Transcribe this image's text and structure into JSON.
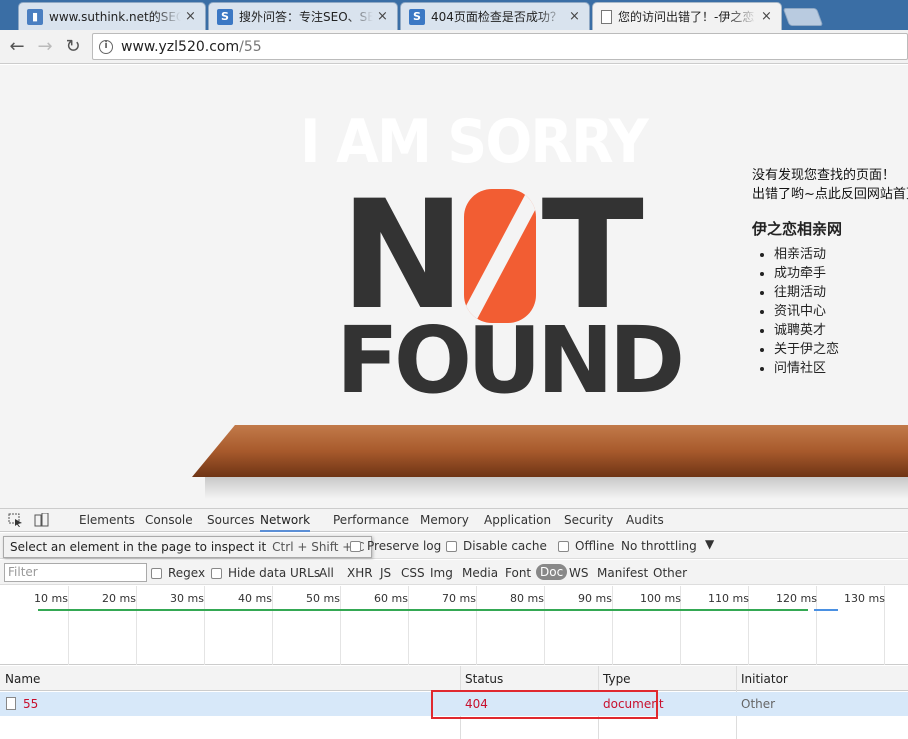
{
  "browser": {
    "tabs": [
      {
        "title": "www.suthink.net的SEO",
        "icon": "suthink-favicon",
        "active": false
      },
      {
        "title": "搜外问答：专注SEO、SE",
        "icon": "seowhy-favicon",
        "active": false
      },
      {
        "title": "404页面检查是否成功？",
        "icon": "seowhy-favicon",
        "active": false
      },
      {
        "title": "您的访问出错了！-伊之恋",
        "icon": "document-icon",
        "active": true
      }
    ],
    "close_glyph": "×",
    "url_host": "www.yzl520.com",
    "url_path": "/55"
  },
  "page": {
    "sorry_text": "I AM SORRY",
    "not_n": "N",
    "not_t": "T",
    "found_text": "FOUND",
    "message_line1": "没有发现您查找的页面！",
    "message_line2": "出错了哟~点此反回网站首页",
    "site_title": "伊之恋相亲网",
    "links": [
      "相亲活动",
      "成功牵手",
      "往期活动",
      "资讯中心",
      "诚聘英才",
      "关于伊之恋",
      "问情社区"
    ],
    "colors": {
      "zero_accent": "#f25d33",
      "text_dark": "#333333",
      "shelf": "#a85a2c"
    }
  },
  "devtools": {
    "tabs": [
      "Elements",
      "Console",
      "Sources",
      "Network",
      "Performance",
      "Memory",
      "Application",
      "Security",
      "Audits"
    ],
    "active_tab": "Network",
    "tooltip_text": "Select an element in the page to inspect it",
    "tooltip_shortcut": "Ctrl + Shift + C",
    "hidden_fragment": "he",
    "preserve_log": "Preserve log",
    "disable_cache": "Disable cache",
    "offline": "Offline",
    "throttling": "No throttling",
    "filter_placeholder": "Filter",
    "regex": "Regex",
    "hide_data_urls": "Hide data URLs",
    "type_filters": [
      "All",
      "XHR",
      "JS",
      "CSS",
      "Img",
      "Media",
      "Font",
      "Doc",
      "WS",
      "Manifest",
      "Other"
    ],
    "selected_type": "Doc",
    "timeline_labels": [
      "10 ms",
      "20 ms",
      "30 ms",
      "40 ms",
      "50 ms",
      "60 ms",
      "70 ms",
      "80 ms",
      "90 ms",
      "100 ms",
      "110 ms",
      "120 ms",
      "130 ms"
    ],
    "columns": [
      "Name",
      "Status",
      "Type",
      "Initiator"
    ],
    "rows": [
      {
        "name": "55",
        "status": "404",
        "type": "document",
        "initiator": "Other"
      }
    ]
  }
}
